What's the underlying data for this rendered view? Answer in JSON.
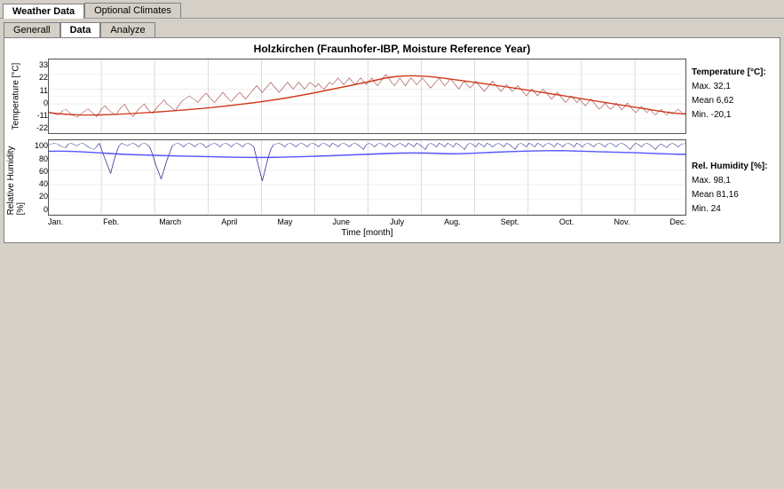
{
  "window": {
    "tabs": [
      {
        "label": "Weather Data",
        "active": true
      },
      {
        "label": "Optional Climates",
        "active": false
      }
    ]
  },
  "content_tabs": [
    {
      "label": "Generall",
      "active": false
    },
    {
      "label": "Data",
      "active": true
    },
    {
      "label": "Analyze",
      "active": false
    }
  ],
  "chart": {
    "title": "Holzkirchen (Fraunhofer-IBP, Moisture Reference Year)",
    "temperature": {
      "y_label": "Temperature [°C]",
      "ticks": [
        "33",
        "22",
        "11",
        "0",
        "-11",
        "-22"
      ],
      "stats_title": "Temperature [°C]:",
      "max": "Max.  32,1",
      "mean": "Mean  6,62",
      "min": "Min.  -20,1"
    },
    "humidity": {
      "y_label": "Relative Humidity [%]",
      "ticks": [
        "100",
        "80",
        "60",
        "40",
        "20",
        "0"
      ],
      "stats_title": "Rel. Humidity [%]:",
      "max": "Max.  98,1",
      "mean": "Mean  81,16",
      "min": "Min.  24"
    },
    "x_ticks": [
      "Jan.",
      "Feb.",
      "March",
      "April",
      "May",
      "June",
      "July",
      "Aug.",
      "Sept.",
      "Oct.",
      "Nov.",
      "Dec."
    ],
    "x_label": "Time [month]"
  }
}
